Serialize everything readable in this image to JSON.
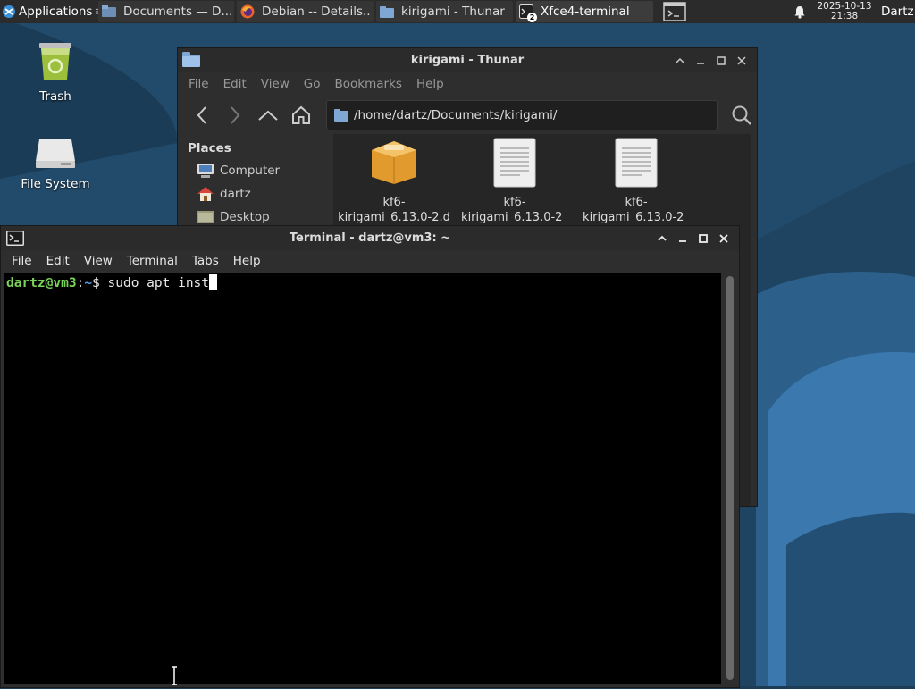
{
  "panel": {
    "applications_label": "Applications",
    "tasks": [
      {
        "label": "Documents — D...",
        "icon": "file-manager-icon"
      },
      {
        "label": "Debian -- Details...",
        "icon": "firefox-icon"
      },
      {
        "label": "kirigami - Thunar",
        "icon": "folder-icon"
      },
      {
        "label": "Xfce4-terminal",
        "icon": "terminal-icon",
        "badge": "2",
        "active": true
      }
    ],
    "show_desktop_icon": "terminal-window-icon",
    "notification_icon": "bell-icon",
    "clock": {
      "date": "2025-10-13",
      "time": "21:38"
    },
    "user": "Dartz"
  },
  "desktop": {
    "icons": [
      {
        "label": "Trash",
        "icon": "trash-icon"
      },
      {
        "label": "File System",
        "icon": "drive-icon"
      }
    ]
  },
  "thunar": {
    "title": "kirigami - Thunar",
    "menu": [
      "File",
      "Edit",
      "View",
      "Go",
      "Bookmarks",
      "Help"
    ],
    "path": "/home/dartz/Documents/kirigami/",
    "places_heading": "Places",
    "places": [
      {
        "label": "Computer",
        "icon": "computer-icon"
      },
      {
        "label": "dartz",
        "icon": "home-icon"
      },
      {
        "label": "Desktop",
        "icon": "desktop-icon"
      }
    ],
    "files": [
      {
        "line1": "kf6-",
        "line2": "kirigami_6.13.0-2.d",
        "icon": "package-icon"
      },
      {
        "line1": "kf6-",
        "line2": "kirigami_6.13.0-2_",
        "icon": "text-document-icon"
      },
      {
        "line1": "kf6-",
        "line2": "kirigami_6.13.0-2_",
        "icon": "text-document-icon"
      }
    ]
  },
  "terminal": {
    "title": "Terminal - dartz@vm3: ~",
    "menu": [
      "File",
      "Edit",
      "View",
      "Terminal",
      "Tabs",
      "Help"
    ],
    "prompt_user": "dartz@vm3",
    "prompt_sep": ":",
    "prompt_path": "~",
    "prompt_symbol": "$",
    "command": "sudo apt inst"
  },
  "colors": {
    "panel_bg": "#2b2b2b",
    "window_bg": "#2e2e2e",
    "desktop_bg": "#1d3c55",
    "prompt_user": "#7cd35a",
    "prompt_path": "#5aa0e6"
  }
}
